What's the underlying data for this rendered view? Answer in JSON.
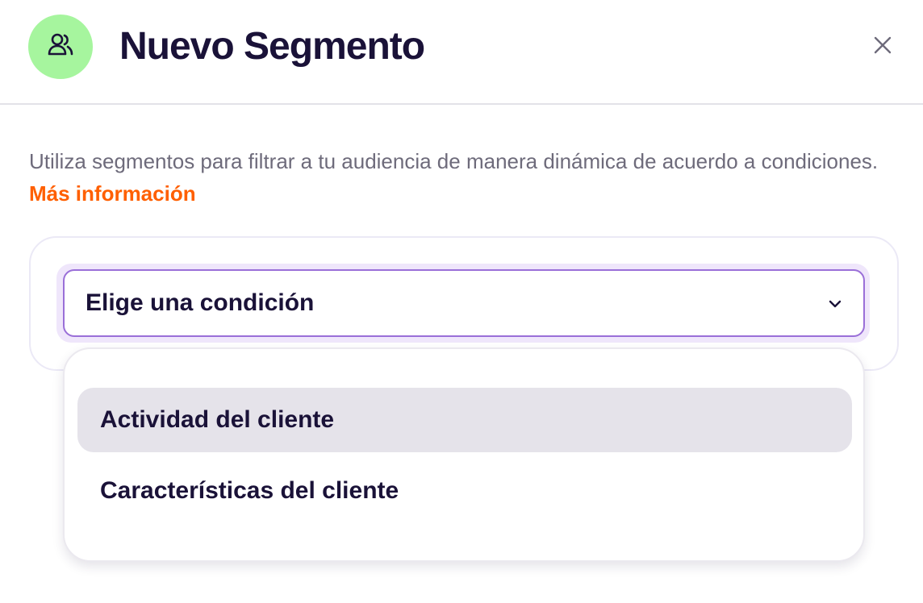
{
  "modal": {
    "title": "Nuevo Segmento",
    "icon": "users-icon",
    "close_icon": "close-icon"
  },
  "description": {
    "text": "Utiliza segmentos para filtrar a tu audiencia de manera dinámica de acuerdo a condiciones.",
    "link_label": "Más información"
  },
  "condition": {
    "placeholder": "Elige una condición",
    "options": [
      {
        "label": "Actividad del cliente",
        "highlighted": true
      },
      {
        "label": "Características del cliente",
        "highlighted": false
      }
    ]
  },
  "colors": {
    "avatar_bg": "#a6f59e",
    "link": "#ff5f00",
    "select_border": "#9a6fd8",
    "highlight": "#e5e3ea",
    "title_text": "#1a1238"
  }
}
